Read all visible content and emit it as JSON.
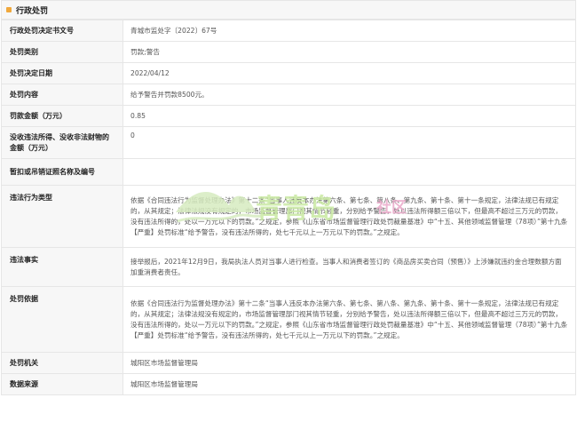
{
  "section": {
    "title": "行政处罚"
  },
  "rows": [
    {
      "label": "行政处罚决定书文号",
      "value": "青城市监处字〔2022〕67号"
    },
    {
      "label": "处罚类别",
      "value": "罚款;警告"
    },
    {
      "label": "处罚决定日期",
      "value": "2022/04/12"
    },
    {
      "label": "处罚内容",
      "value": "给予警告并罚款8500元。"
    },
    {
      "label": "罚款金额（万元）",
      "value": "0.85"
    },
    {
      "label": "没收违法所得、没收非法财物的金额（万元）",
      "value": "0"
    },
    {
      "label": "暂扣或吊销证照名称及编号",
      "value": ""
    },
    {
      "label": "违法行为类型",
      "value": "依据《合同违法行为监督处理办法》第十二条“当事人违反本办法第六条、第七条、第八条、第九条、第十条、第十一条规定，法律法规已有规定的，从其规定；法律法规没有规定的，市场监督管理部门视其情节轻重，分别给予警告，处以违法所得额三倍以下，但最高不超过三万元的罚款，没有违法所得的，处以一万元以下的罚款。”之规定，参照《山东省市场监督管理行政处罚裁量基准》中“十五、其他领域监督管理（78项）”第十九条【严重】处罚标准“给予警告，没有违法所得的，处七千元以上一万元以下的罚款。”之规定。"
    },
    {
      "label": "违法事实",
      "value": "接举报后，2021年12月9日，我局执法人员对当事人进行检查。当事人和消费者签订的《商品房买卖合同（预售）》上涉嫌就违约金合理数额方面加重消费者责任。"
    },
    {
      "label": "处罚依据",
      "value": "依据《合同违法行为监督处理办法》第十二条“当事人违反本办法第六条、第七条、第八条、第九条、第十条、第十一条规定，法律法规已有规定的，从其规定；法律法规没有规定的，市场监督管理部门视其情节轻重，分别给予警告，处以违法所得额三倍以下，但最高不超过三万元的罚款，没有违法所得的，处以一万元以下的罚款。”之规定，参照《山东省市场监督管理行政处罚裁量基准》中“十五、其他领域监督管理（78项）”第十九条【严重】处罚标准“给予警告，没有违法所得的，处七千元以上一万元以下的罚款。”之规定。"
    },
    {
      "label": "处罚机关",
      "value": "城阳区市场监督管理局"
    },
    {
      "label": "数据来源",
      "value": "城阳区市场监督管理局"
    }
  ],
  "watermark": {
    "text": "青青岛",
    "sub": "社区"
  }
}
